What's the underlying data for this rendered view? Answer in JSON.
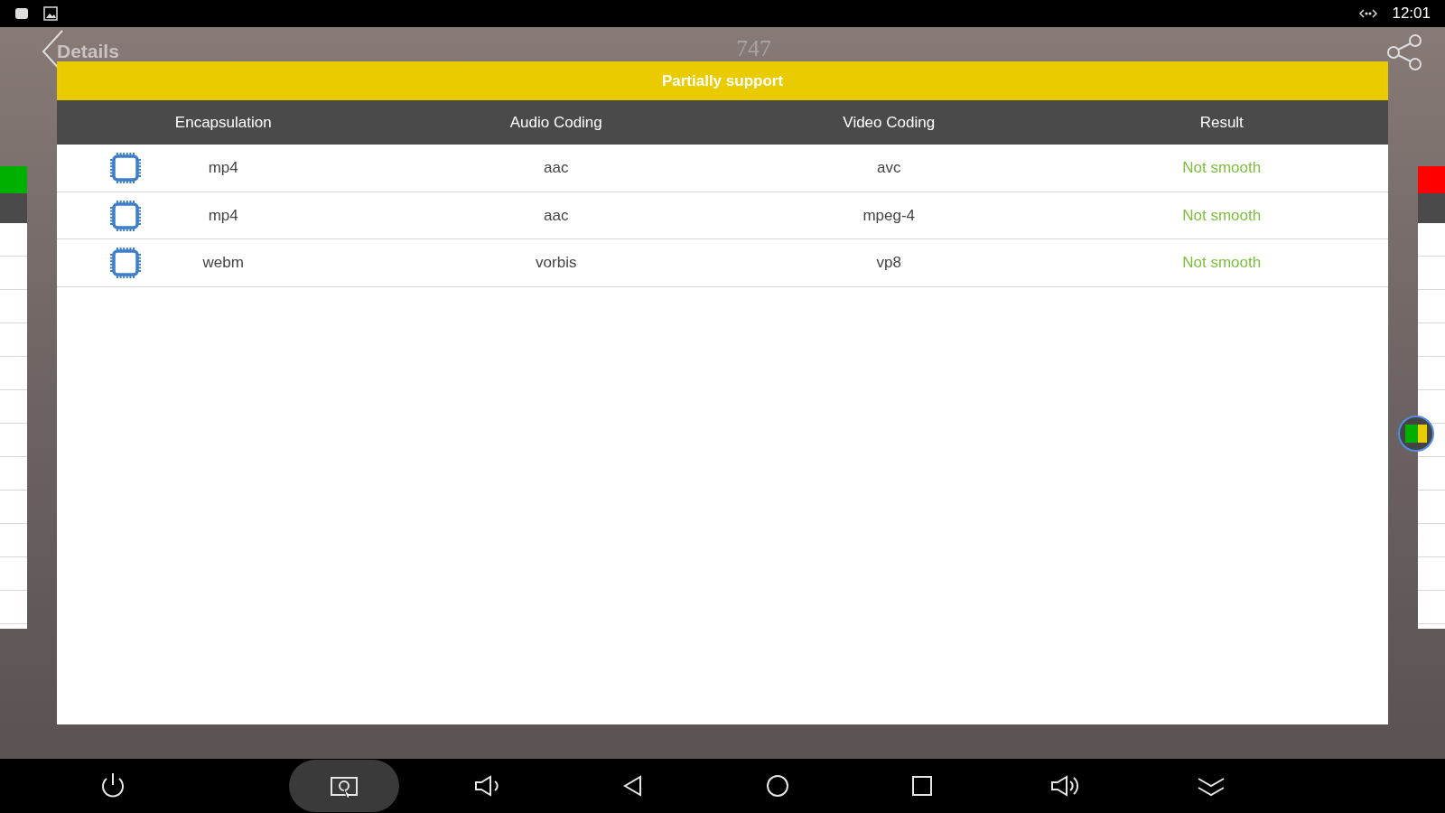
{
  "status_bar": {
    "time": "12:01"
  },
  "header": {
    "title": "Details",
    "number": "747"
  },
  "banner": {
    "text": "Partially support"
  },
  "table": {
    "columns": [
      "Encapsulation",
      "Audio Coding",
      "Video Coding",
      "Result"
    ],
    "rows": [
      {
        "encapsulation": "mp4",
        "audio": "aac",
        "video": "avc",
        "result": "Not smooth"
      },
      {
        "encapsulation": "mp4",
        "audio": "aac",
        "video": "mpeg-4",
        "result": "Not smooth"
      },
      {
        "encapsulation": "webm",
        "audio": "vorbis",
        "video": "vp8",
        "result": "Not smooth"
      }
    ]
  },
  "side_pages": [
    {
      "color": "#00b000"
    },
    {
      "color": "#ff0000"
    }
  ],
  "nav_bar": [
    {
      "kind": "power",
      "selected": false
    },
    {
      "kind": "screenshot",
      "selected": true
    },
    {
      "kind": "volume-down",
      "selected": false
    },
    {
      "kind": "back",
      "selected": false
    },
    {
      "kind": "home",
      "selected": false
    },
    {
      "kind": "recents",
      "selected": false
    },
    {
      "kind": "volume-up",
      "selected": false
    },
    {
      "kind": "collapse",
      "selected": false
    }
  ]
}
